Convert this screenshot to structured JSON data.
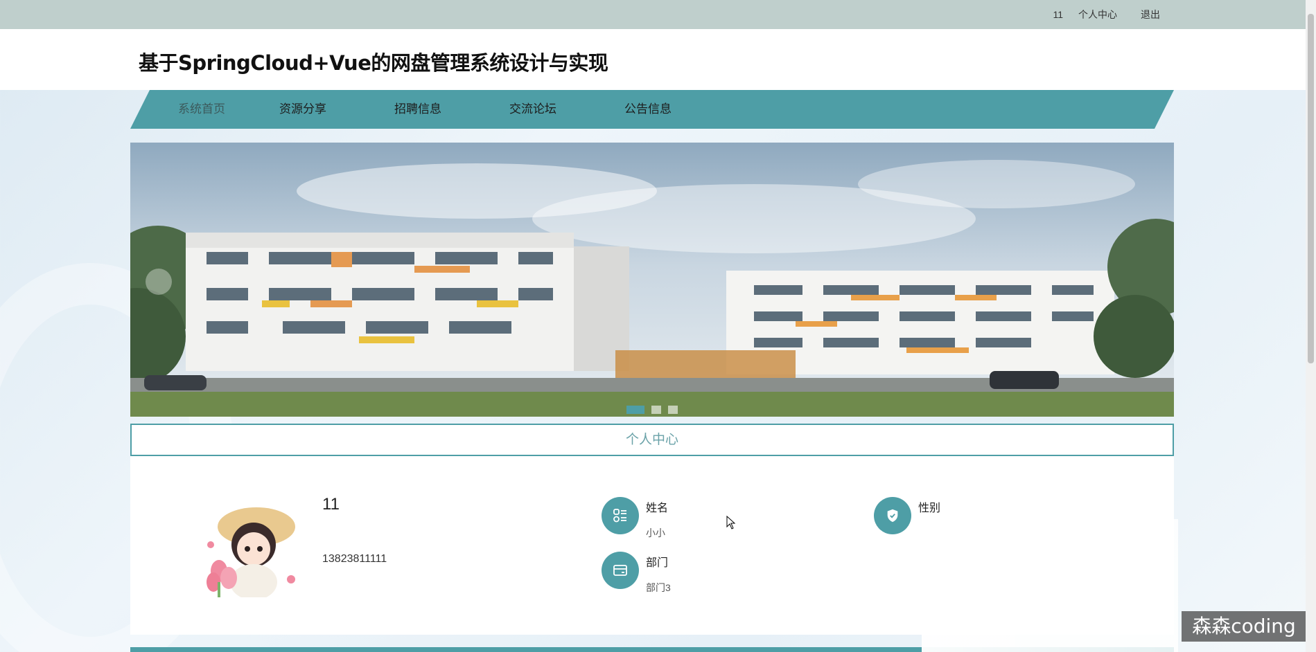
{
  "topbar": {
    "username": "11",
    "profile_link": "个人中心",
    "logout_link": "退出"
  },
  "header": {
    "title": "基于SpringCloud+Vue的网盘管理系统设计与实现"
  },
  "nav": {
    "items": [
      {
        "label": "系统首页",
        "active": true
      },
      {
        "label": "资源分享",
        "active": false
      },
      {
        "label": "招聘信息",
        "active": false
      },
      {
        "label": "交流论坛",
        "active": false
      },
      {
        "label": "公告信息",
        "active": false
      }
    ]
  },
  "banner": {
    "slide_count": 3,
    "active_slide": 1
  },
  "section": {
    "title": "个人中心"
  },
  "profile": {
    "username": "11",
    "phone": "13823811111",
    "fields": [
      {
        "label": "姓名",
        "value": "小小",
        "icon": "list-icon"
      },
      {
        "label": "性别",
        "value": "",
        "icon": "shield-icon"
      },
      {
        "label": "部门",
        "value": "部门3",
        "icon": "card-icon"
      }
    ]
  },
  "watermark": {
    "text": "森森coding"
  },
  "colors": {
    "accent": "#4e9ea6",
    "topbar": "#bfcfcc"
  }
}
